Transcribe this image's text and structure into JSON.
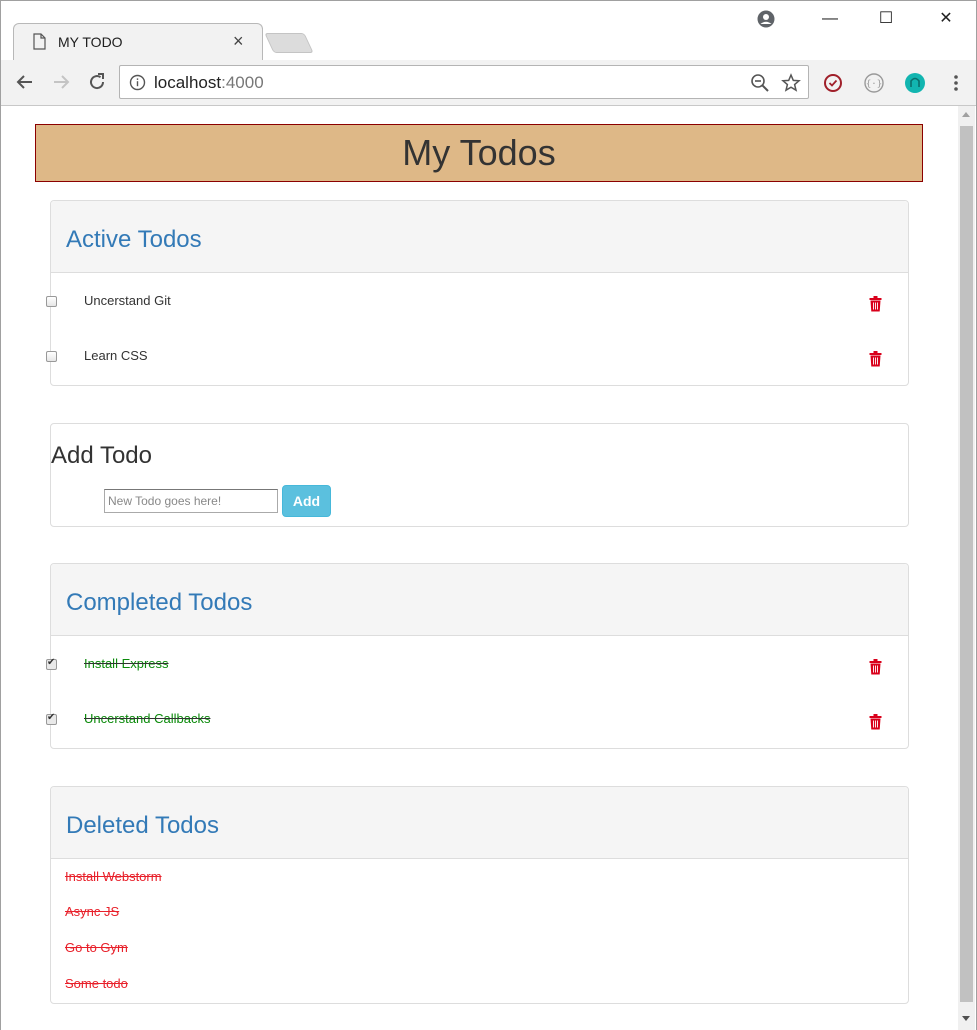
{
  "browser": {
    "tab_title": "MY TODO",
    "tab_close": "×",
    "url_host": "localhost",
    "url_port": ":4000",
    "window_controls": {
      "minimize": "—",
      "maximize": "☐",
      "close": "✕"
    },
    "icons": [
      "profile-icon",
      "document-icon",
      "back-arrow-icon",
      "forward-arrow-icon",
      "reload-icon",
      "info-icon",
      "zoom-out-icon",
      "bookmark-star-icon",
      "extension-clock-icon",
      "extension-braces-icon",
      "extension-teal-icon",
      "menu-kebab-icon"
    ]
  },
  "app": {
    "title": "My Todos",
    "active": {
      "heading": "Active Todos",
      "items": [
        {
          "text": "Uncerstand Git",
          "checked": false
        },
        {
          "text": "Learn CSS",
          "checked": false
        }
      ]
    },
    "add": {
      "heading": "Add Todo",
      "placeholder": "New Todo goes here!",
      "button_label": "Add"
    },
    "completed": {
      "heading": "Completed Todos",
      "items": [
        {
          "text": "Install Express",
          "checked": true
        },
        {
          "text": "Uncerstand Callbacks",
          "checked": true
        }
      ]
    },
    "deleted": {
      "heading": "Deleted Todos",
      "items": [
        {
          "text": "Install Webstorm"
        },
        {
          "text": "Async JS"
        },
        {
          "text": "Go to Gym"
        },
        {
          "text": "Some todo"
        }
      ]
    }
  },
  "colors": {
    "header_bg": "#deb887",
    "header_border": "#8b0000",
    "panel_title": "#337ab7",
    "completed_text": "#0a8a0a",
    "deleted_text": "#e8202a",
    "trash_icon": "#d9001b",
    "add_button": "#5bc0de"
  }
}
